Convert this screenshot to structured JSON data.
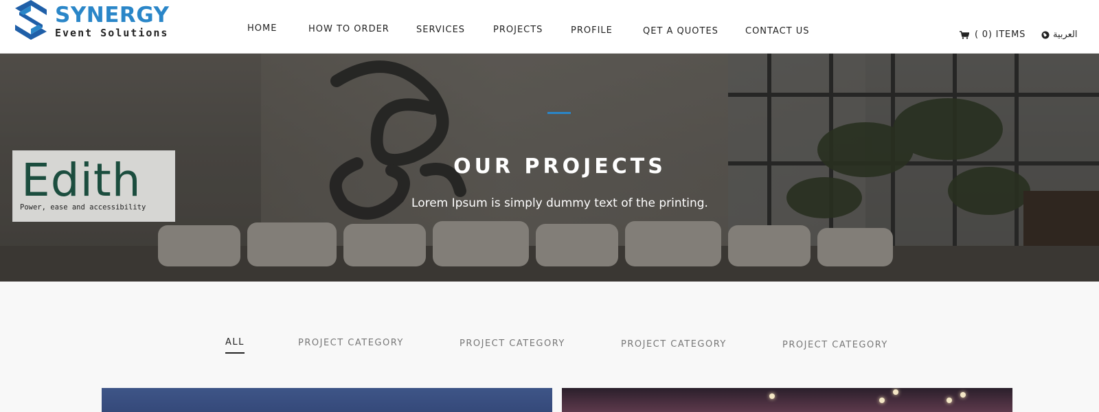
{
  "brand": {
    "name": "SYNERGY",
    "tagline": "Event Solutions",
    "color": "#2a86c8"
  },
  "nav": {
    "items": [
      {
        "label": "HOME"
      },
      {
        "label": "HOW TO ORDER"
      },
      {
        "label": "SERVICES"
      },
      {
        "label": "PROJECTS"
      },
      {
        "label": "PROFILE"
      },
      {
        "label": "QET A QUOTES"
      },
      {
        "label": "CONTACT US"
      }
    ]
  },
  "cart": {
    "icon": "cart-icon",
    "label": "( 0) ITEMS"
  },
  "language": {
    "icon": "globe-icon",
    "label": "العربية"
  },
  "hero": {
    "title": "OUR PROJECTS",
    "subtitle": "Lorem Ipsum is simply dummy text of the printing.",
    "accent_color": "#2a86c8"
  },
  "badge": {
    "word": "Edith",
    "tagline": "Power, ease and accessibility"
  },
  "filters": {
    "items": [
      {
        "label": "ALL",
        "active": true
      },
      {
        "label": "PROJECT CATEGORY"
      },
      {
        "label": "PROJECT CATEGORY"
      },
      {
        "label": "PROJECT CATEGORY"
      },
      {
        "label": "PROJECT CATEGORY"
      }
    ]
  }
}
